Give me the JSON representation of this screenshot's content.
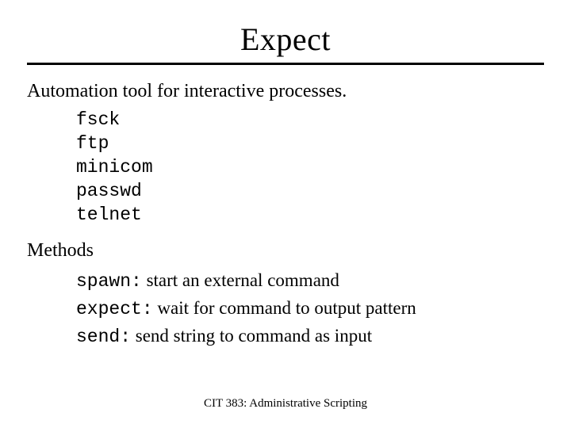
{
  "title": "Expect",
  "subtitle": "Automation tool for interactive processes.",
  "tools": [
    "fsck",
    "ftp",
    "minicom",
    "passwd",
    "telnet"
  ],
  "methods_heading": "Methods",
  "methods": [
    {
      "name": "spawn:",
      "desc": " start an external command"
    },
    {
      "name": "expect:",
      "desc": " wait for command to output pattern"
    },
    {
      "name": "send:",
      "desc": " send string to command as input"
    }
  ],
  "footer": "CIT 383: Administrative Scripting"
}
